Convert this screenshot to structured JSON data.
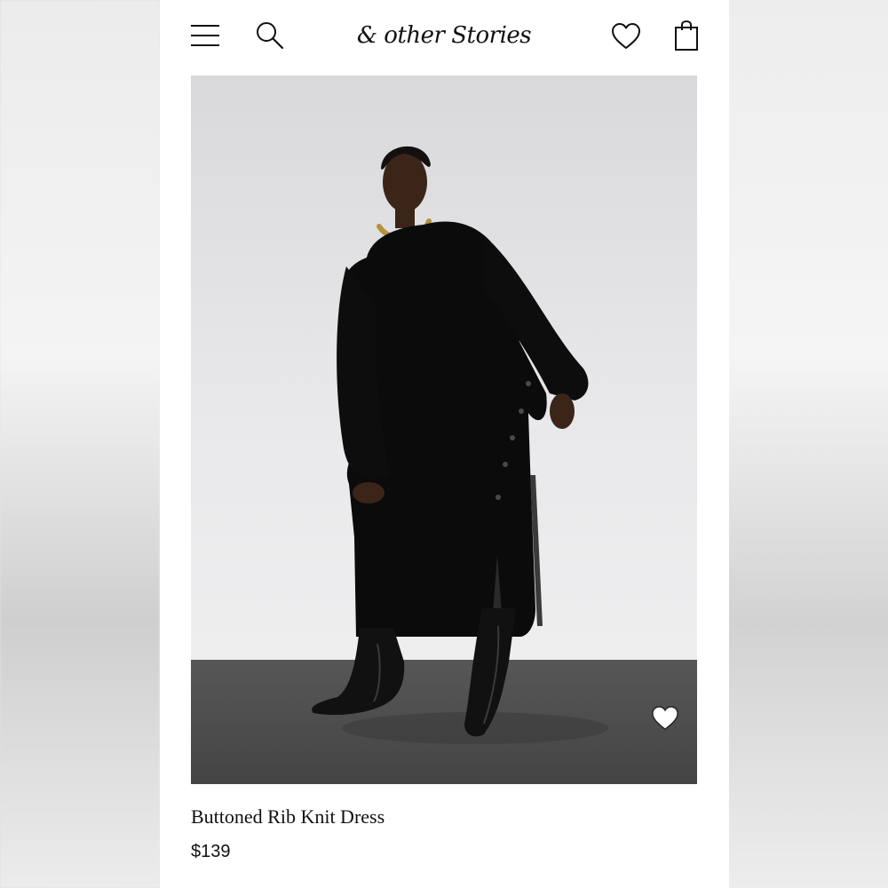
{
  "header": {
    "logo_text": "& other Stories",
    "icons": {
      "menu": "hamburger-menu-icon",
      "search": "search-icon",
      "wishlist": "heart-outline-icon",
      "bag": "shopping-bag-icon"
    }
  },
  "product": {
    "title": "Buttoned Rib Knit Dress",
    "price": "$139",
    "image": {
      "subject": "model in black rib knit midi dress with side buttons and black boots",
      "favorite_icon": "heart-filled-icon"
    }
  },
  "colors": {
    "text": "#111111",
    "page_background": "#ffffff",
    "image_wall": "#e4e4e6",
    "image_floor": "#4b4b4b",
    "dress": "#0b0b0b"
  }
}
